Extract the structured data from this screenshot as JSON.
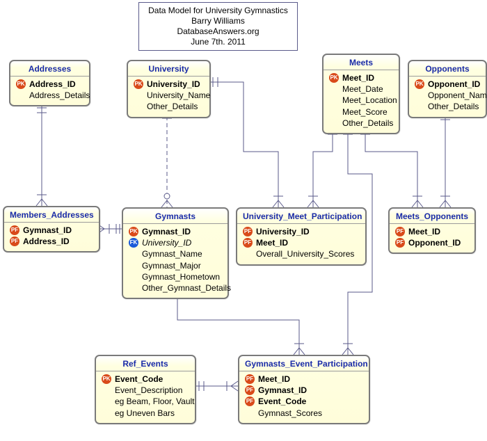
{
  "title": {
    "line1": "Data Model for University Gymnastics",
    "line2": "Barry Williams",
    "line3": "DatabaseAnswers.org",
    "line4": "June 7th. 2011"
  },
  "entities": {
    "addresses": {
      "name": "Addresses",
      "fields": [
        {
          "key": "PK",
          "label": "Address_ID",
          "bold": true
        },
        {
          "key": "",
          "label": "Address_Details"
        }
      ]
    },
    "university": {
      "name": "University",
      "fields": [
        {
          "key": "PK",
          "label": "University_ID",
          "bold": true
        },
        {
          "key": "",
          "label": "University_Name"
        },
        {
          "key": "",
          "label": "Other_Details"
        }
      ]
    },
    "meets": {
      "name": "Meets",
      "fields": [
        {
          "key": "PK",
          "label": "Meet_ID",
          "bold": true
        },
        {
          "key": "",
          "label": "Meet_Date"
        },
        {
          "key": "",
          "label": "Meet_Location"
        },
        {
          "key": "",
          "label": "Meet_Score"
        },
        {
          "key": "",
          "label": "Other_Details"
        }
      ]
    },
    "opponents": {
      "name": "Opponents",
      "fields": [
        {
          "key": "PK",
          "label": "Opponent_ID",
          "bold": true
        },
        {
          "key": "",
          "label": "Opponent_Name"
        },
        {
          "key": "",
          "label": "Other_Details"
        }
      ]
    },
    "members_addresses": {
      "name": "Members_Addresses",
      "fields": [
        {
          "key": "PF",
          "label": "Gymnast_ID",
          "bold": true
        },
        {
          "key": "PF",
          "label": "Address_ID",
          "bold": true
        }
      ]
    },
    "gymnasts": {
      "name": "Gymnasts",
      "fields": [
        {
          "key": "PK",
          "label": "Gymnast_ID",
          "bold": true
        },
        {
          "key": "FK",
          "label": "University_ID",
          "italic": true
        },
        {
          "key": "",
          "label": "Gymnast_Name"
        },
        {
          "key": "",
          "label": "Gymnast_Major"
        },
        {
          "key": "",
          "label": "Gymnast_Hometown"
        },
        {
          "key": "",
          "label": "Other_Gymnast_Details"
        }
      ]
    },
    "umt": {
      "name": "University_Meet_Participation",
      "fields": [
        {
          "key": "PF",
          "label": "University_ID",
          "bold": true
        },
        {
          "key": "PF",
          "label": "Meet_ID",
          "bold": true
        },
        {
          "key": "",
          "label": "Overall_University_Scores"
        }
      ]
    },
    "meets_opponents": {
      "name": "Meets_Opponents",
      "fields": [
        {
          "key": "PF",
          "label": "Meet_ID",
          "bold": true
        },
        {
          "key": "PF",
          "label": "Opponent_ID",
          "bold": true
        }
      ]
    },
    "ref_events": {
      "name": "Ref_Events",
      "fields": [
        {
          "key": "PK",
          "label": "Event_Code",
          "bold": true
        },
        {
          "key": "",
          "label": "Event_Description"
        },
        {
          "key": "",
          "label": "eg Beam, Floor, Vault"
        },
        {
          "key": "",
          "label": "eg Uneven Bars"
        }
      ]
    },
    "gep": {
      "name": "Gymnasts_Event_Participation",
      "fields": [
        {
          "key": "PF",
          "label": "Meet_ID",
          "bold": true
        },
        {
          "key": "PF",
          "label": "Gymnast_ID",
          "bold": true
        },
        {
          "key": "PF",
          "label": "Event_Code",
          "bold": true
        },
        {
          "key": "",
          "label": "Gymnast_Scores"
        }
      ]
    }
  },
  "key_labels": {
    "PK": "PK",
    "PF": "PF",
    "FK": "FK"
  }
}
